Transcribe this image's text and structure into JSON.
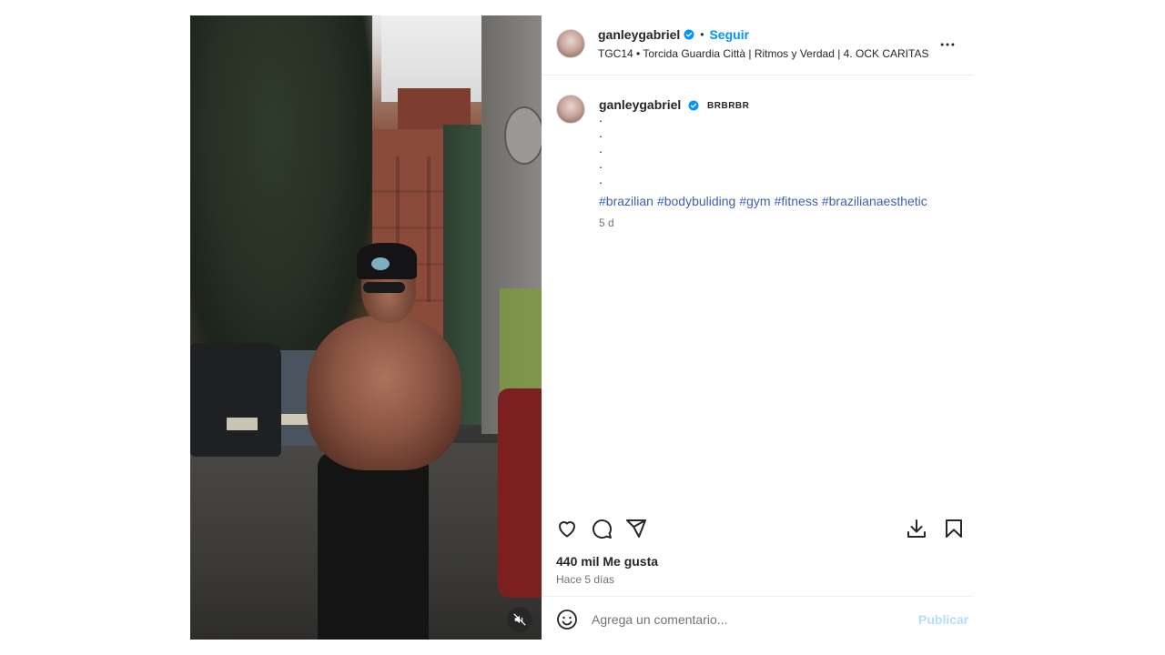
{
  "post": {
    "username": "ganleygabriel",
    "follow_label": "Seguir",
    "separator": "•",
    "audio_line": "TGC14 • Torcida Guardia Città | Ritmos y Verdad | 4. OCK CARITAS",
    "more_icon": "more-horizontal-icon"
  },
  "caption": {
    "username": "ganleygabriel",
    "badge_text": "BRBRBR",
    "dots": [
      ".",
      ".",
      ".",
      ".",
      "."
    ],
    "hashtags": [
      "#brazilian",
      "#bodybuliding",
      "#gym",
      "#fitness",
      "#brazilianaesthetic"
    ],
    "age": "5 d"
  },
  "actions": {
    "icons": [
      "heart-icon",
      "comment-icon",
      "share-icon",
      "download-icon",
      "bookmark-icon"
    ]
  },
  "stats": {
    "likes": "440 mil Me gusta",
    "posted": "Hace 5 días"
  },
  "comment": {
    "placeholder": "Agrega un comentario...",
    "publish_label": "Publicar"
  },
  "colors": {
    "accent": "#0095f6",
    "hashtag": "#3f5fb5",
    "publish_disabled": "#b2dffc",
    "muted_text": "#737373"
  }
}
